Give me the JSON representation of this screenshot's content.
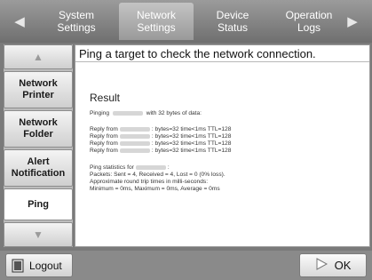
{
  "tabs": [
    {
      "line1": "System",
      "line2": "Settings"
    },
    {
      "line1": "Network",
      "line2": "Settings"
    },
    {
      "line1": "Device",
      "line2": "Status"
    },
    {
      "line1": "Operation",
      "line2": "Logs"
    }
  ],
  "sidebar": {
    "items": [
      {
        "label": "Network Printer"
      },
      {
        "label": "Network Folder"
      },
      {
        "label": "Alert Notification"
      },
      {
        "label": "Ping"
      }
    ]
  },
  "main": {
    "instruction": "Ping a target to check the network connection.",
    "result_title": "Result",
    "pinging_prefix": "Pinging",
    "pinging_suffix": "with 32 bytes of data:",
    "reply_prefix": "Reply from",
    "reply_suffix": ": bytes=32 time<1ms TTL=128",
    "stats_prefix": "Ping statistics for",
    "stats_suffix": ":",
    "packets": "Packets: Sent = 4, Received = 4, Lost = 0 (0% loss).",
    "approx": "Approximate round trip times in milli-seconds:",
    "minmax": "Minimum = 0ms, Maximum = 0ms, Average = 0ms"
  },
  "footer": {
    "logout_label": "Logout",
    "ok_label": "OK"
  },
  "icons": {
    "prev": "triangle-left-icon",
    "next": "triangle-right-icon",
    "up": "triangle-up-icon",
    "down": "triangle-down-icon",
    "logout": "logout-door-icon",
    "ok": "play-triangle-icon"
  }
}
